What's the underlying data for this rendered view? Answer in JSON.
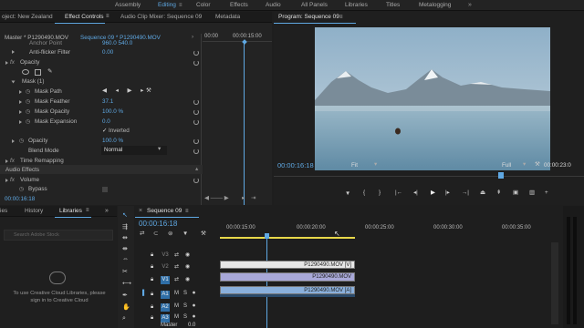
{
  "workspaces": [
    "Assembly",
    "Editing",
    "Color",
    "Effects",
    "Audio",
    "All Panels",
    "Libraries",
    "Titles",
    "Metalogging"
  ],
  "active_workspace": "Editing",
  "top_tabs": {
    "project": "oject: New Zealand",
    "effect_controls": "Effect Controls",
    "audio_mixer": "Audio Clip Mixer: Sequence 09",
    "metadata": "Metadata"
  },
  "ec": {
    "master": "Master * P1290490.MOV",
    "sequence": "Sequence 09 * P1290490.MOV",
    "timecode_top": "00:00",
    "timecode_top2": "00:00:15:00",
    "anchor_label": "Anchor Point",
    "anchor_value": "960.0  540.0",
    "anti_flicker_label": "Anti-flicker Filter",
    "anti_flicker_value": "0.00",
    "opacity_label": "Opacity",
    "mask_label": "Mask (1)",
    "mask_path_label": "Mask Path",
    "mask_feather_label": "Mask Feather",
    "mask_feather_value": "37.1",
    "mask_opacity_label": "Mask Opacity",
    "mask_opacity_value": "100.0 %",
    "mask_expansion_label": "Mask Expansion",
    "mask_expansion_value": "0.0",
    "inverted_label": "Inverted",
    "opacity2_label": "Opacity",
    "opacity2_value": "100.0 %",
    "blend_label": "Blend Mode",
    "blend_value": "Normal",
    "time_remap_label": "Time Remapping",
    "audio_effects_label": "Audio Effects",
    "volume_label": "Volume",
    "bypass_label": "Bypass",
    "timecode_bottom": "00:00:16:18"
  },
  "program": {
    "title": "Program: Sequence 09",
    "timecode": "00:00:16:18",
    "fit": "Fit",
    "full": "Full",
    "duration": "00:00:23:0"
  },
  "bottom_left": {
    "tabs": [
      "ies",
      "History",
      "Libraries"
    ],
    "search_placeholder": "Search Adobe Stock",
    "message": "To use Creative Cloud Libraries, please sign in to Creative Cloud"
  },
  "timeline": {
    "tab": "Sequence 09",
    "timecode": "00:00:16:18",
    "ruler": [
      "00:00:15:00",
      "00:00:20:00",
      "00:00:25:00",
      "00:00:30:00",
      "00:00:35:00"
    ],
    "tracks": [
      "V3",
      "V2",
      "V1",
      "A1",
      "A2",
      "A3"
    ],
    "master_label": "Master",
    "master_value": "0.0",
    "clips": [
      "P1290490.MOV [V]",
      "P1290490.MOV",
      "P1290490.MOV [A]"
    ]
  },
  "colors": {
    "accent": "#5fa8e3",
    "clip_video": "#a8a8d8",
    "clip_audio": "#8ab0dc"
  }
}
